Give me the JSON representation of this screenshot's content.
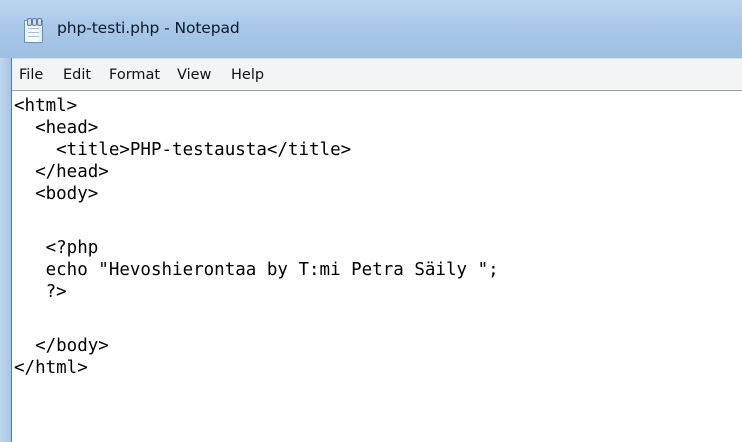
{
  "window": {
    "title": "php-testi.php - Notepad",
    "icon": "notepad-icon"
  },
  "menu": {
    "items": [
      {
        "label": "File"
      },
      {
        "label": "Edit"
      },
      {
        "label": "Format"
      },
      {
        "label": "View"
      },
      {
        "label": "Help"
      }
    ]
  },
  "editor": {
    "lines": [
      "<html>",
      "  <head>",
      "    <title>PHP-testausta</title>",
      "  </head>",
      "  <body>",
      "",
      "   <?php",
      "   echo \"Hevoshierontaa by T:mi Petra Säily \";",
      "   ?>",
      "",
      "  </body>",
      "</html>"
    ]
  },
  "colors": {
    "titlebar": "#a9c8e9",
    "menubar": "#f2f4f8",
    "editor_bg": "#ffffff",
    "text": "#000000"
  }
}
